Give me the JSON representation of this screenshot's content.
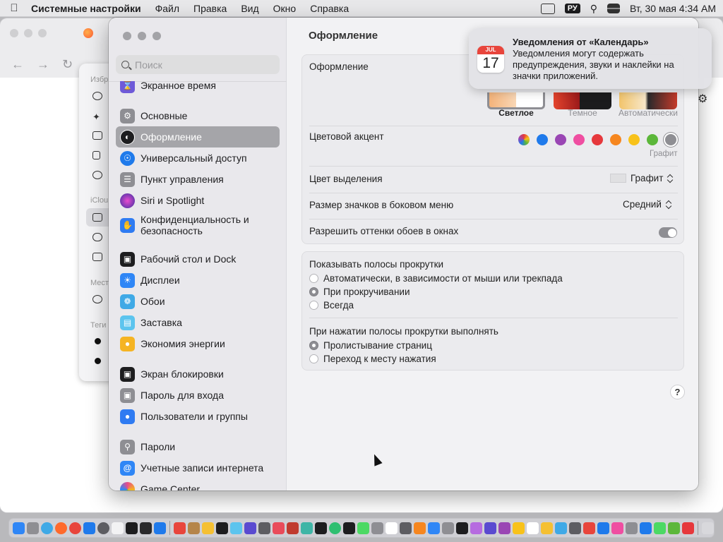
{
  "menubar": {
    "app": "Системные настройки",
    "items": [
      "Файл",
      "Правка",
      "Вид",
      "Окно",
      "Справка"
    ],
    "lang": "РУ",
    "clock": "Вт, 30 мая  4:34 AM"
  },
  "finder": {
    "labels": [
      "Избр",
      "iClou",
      "Мест",
      "Теги"
    ]
  },
  "search": {
    "placeholder": "Поиск"
  },
  "sidebar": {
    "items": [
      {
        "label": "Экранное время",
        "color": "#6e5ad8"
      },
      {
        "label": "Основные",
        "color": "#8e8e93"
      },
      {
        "label": "Оформление",
        "color": "#1d1d1f"
      },
      {
        "label": "Универсальный доступ",
        "color": "#1f7aeb"
      },
      {
        "label": "Пункт управления",
        "color": "#8e8e93"
      },
      {
        "label": "Siri и Spotlight",
        "color": "#c535c8"
      },
      {
        "label": "Конфиденциальность и безопасность",
        "color": "#2f7bf2"
      },
      {
        "label": "Рабочий стол и Dock",
        "color": "#1d1d1f"
      },
      {
        "label": "Дисплеи",
        "color": "#2f86f6"
      },
      {
        "label": "Обои",
        "color": "#3fa9e6"
      },
      {
        "label": "Заставка",
        "color": "#5cc4ee"
      },
      {
        "label": "Экономия энергии",
        "color": "#f5b423"
      },
      {
        "label": "Экран блокировки",
        "color": "#1d1d1f"
      },
      {
        "label": "Пароль для входа",
        "color": "#8e8e93"
      },
      {
        "label": "Пользователи и группы",
        "color": "#2f7bf2"
      },
      {
        "label": "Пароли",
        "color": "#8e8e93"
      },
      {
        "label": "Учетные записи интернета",
        "color": "#2f86f6"
      },
      {
        "label": "Game Center",
        "color": "#e94b8a"
      }
    ]
  },
  "content": {
    "title": "Оформление",
    "appearance_label": "Оформление",
    "appearance_options": [
      {
        "label": "Светлое"
      },
      {
        "label": "Темное"
      },
      {
        "label": "Автоматически"
      }
    ],
    "accent_label": "Цветовой акцент",
    "accent_colors": [
      "#b66be0",
      "#1f7aeb",
      "#9a46b4",
      "#ef4ea1",
      "#e6383c",
      "#f6861f",
      "#f8c21a",
      "#5cb73a",
      "#8e8e93"
    ],
    "accent_selected_name": "Графит",
    "highlight_label": "Цвет выделения",
    "highlight_value": "Графит",
    "sidebar_icon_label": "Размер значков в боковом меню",
    "sidebar_icon_value": "Средний",
    "wallpaper_tint_label": "Разрешить оттенки обоев в окнах",
    "wallpaper_tint_on": true,
    "scrollbars_label": "Показывать полосы прокрутки",
    "scrollbars_options": [
      "Автоматически, в зависимости от мыши или трекпада",
      "При прокручивании",
      "Всегда"
    ],
    "scrollbars_selected": 1,
    "click_label": "При нажатии полосы прокрутки выполнять",
    "click_options": [
      "Пролистывание страниц",
      "Переход к месту нажатия"
    ],
    "click_selected": 0,
    "help": "?"
  },
  "notification": {
    "month": "JUL",
    "day": "17",
    "title": "Уведомления от «Календарь»",
    "body": "Уведомления могут содержать предупреждения, звуки и наклейки на значки приложений."
  }
}
